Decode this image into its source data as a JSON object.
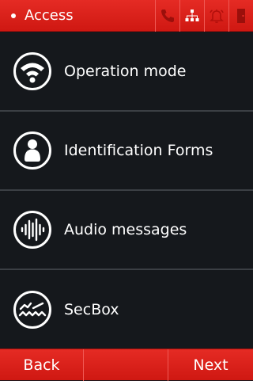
{
  "header": {
    "title": "Access",
    "status_icons": [
      "phone-icon",
      "network-icon",
      "bell-icon",
      "door-icon"
    ]
  },
  "menu": {
    "items": [
      {
        "label": "Operation mode",
        "icon": "operation-mode-icon"
      },
      {
        "label": "Identification Forms",
        "icon": "identification-icon"
      },
      {
        "label": "Audio messages",
        "icon": "audio-waveform-icon"
      },
      {
        "label": "SecBox",
        "icon": "secbox-icon"
      }
    ]
  },
  "footer": {
    "back_label": "Back",
    "next_label": "Next"
  },
  "colors": {
    "bar_red": "#e52b24",
    "background": "#15181c",
    "separator": "#3b3f44"
  }
}
